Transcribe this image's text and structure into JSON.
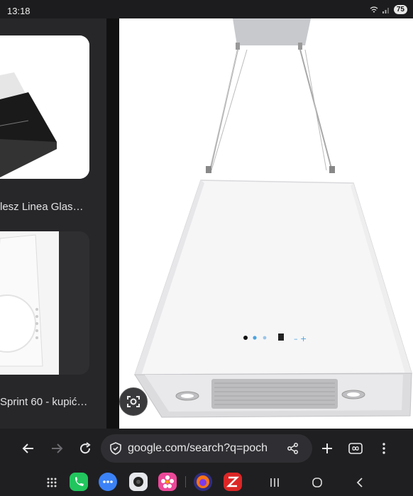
{
  "status": {
    "time": "13:18",
    "battery": "75"
  },
  "results": {
    "caption_1": "lesz Linea Glas…",
    "caption_2": "Sprint 60 - kupić…"
  },
  "browser": {
    "url": "google.com/search?q=poch"
  },
  "colors": {
    "background": "#1f1f21",
    "url_pill": "#2f2f33",
    "phone_app": "#22c55e",
    "messages_app": "#3b82f6",
    "firefox_app": "#f97316"
  }
}
